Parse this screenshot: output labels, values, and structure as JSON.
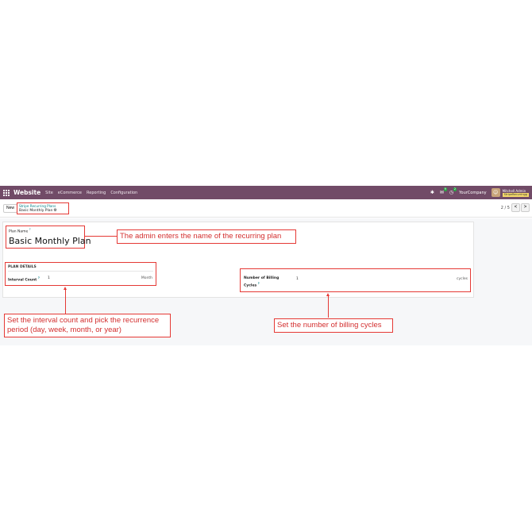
{
  "navbar": {
    "brand": "Website",
    "menu": [
      "Site",
      "eCommerce",
      "Reporting",
      "Configuration"
    ],
    "chat_badge": "9",
    "activity_badge": "2",
    "company": "YourCompany",
    "user_name": "Mitchell Admin",
    "db_name": "StripeRecurringg"
  },
  "control": {
    "new_label": "New",
    "breadcrumb_parent": "Stripe Recurring Plans",
    "breadcrumb_current": "Basic Monthly Plan",
    "pager": "2 / 5",
    "prev": "<",
    "next": ">"
  },
  "form": {
    "plan_name_label": "Plan Name",
    "plan_name_value": "Basic Monthly Plan",
    "section_title": "PLAN DETAILS",
    "interval_count_label": "Interval Count",
    "interval_count_value": "1",
    "interval_unit": "Month",
    "billing_cycles_label": "Number of Billing Cycles",
    "billing_cycles_value": "1",
    "billing_cycles_unit": "cycles",
    "help_marker": "?"
  },
  "annotations": {
    "plan_name": "The admin enters the name of the recurring plan",
    "interval": "Set the interval count and pick the recurrence period (day, week, month, or year)",
    "cycles": "Set the number of billing cycles"
  },
  "colors": {
    "navbar": "#714b67",
    "annotation": "#e53935",
    "link": "#017e84"
  }
}
